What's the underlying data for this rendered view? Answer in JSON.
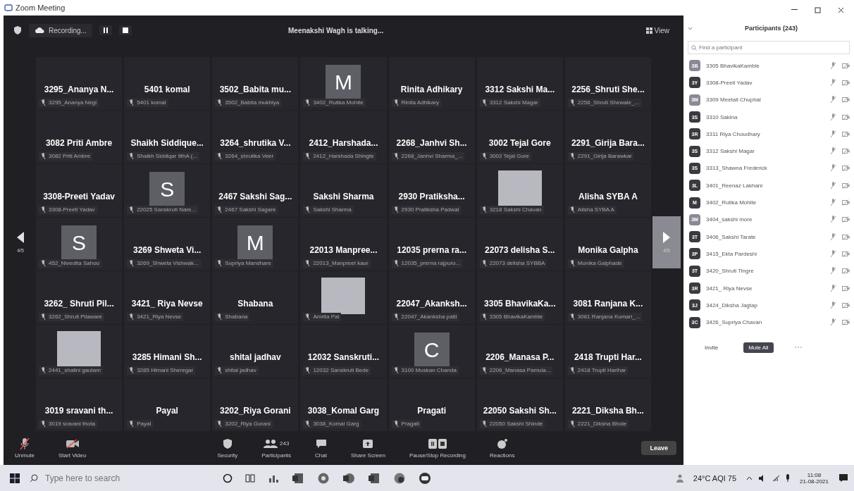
{
  "window": {
    "title": "Zoom Meeting"
  },
  "top_bar": {
    "recording": "Recording...",
    "talking": "Meenakshi Wagh is talking...",
    "view": "View"
  },
  "pager": {
    "prev_page": "4/5",
    "next_page": "4/5"
  },
  "tiles": [
    {
      "kind": "name",
      "title": "3295_Ananya N...",
      "label": "3295_Ananya Negi"
    },
    {
      "kind": "name",
      "title": "5401 komal",
      "label": "5401 komal"
    },
    {
      "kind": "name",
      "title": "3502_Babita mu...",
      "label": "3502_Babita mukhiya"
    },
    {
      "kind": "letter",
      "title": "M",
      "label": "3402_Rutika Mohite"
    },
    {
      "kind": "name",
      "title": "Rinita Adhikary",
      "label": "Rinita Adhikary"
    },
    {
      "kind": "name",
      "title": "3312 Sakshi Ma...",
      "label": "3312 Sakshi Magar"
    },
    {
      "kind": "name",
      "title": "2256_Shruti She...",
      "label": "2256_Shruti Shewale_..."
    },
    {
      "kind": "name",
      "title": "3082 Priti Ambre",
      "label": "3082 Priti Ambre"
    },
    {
      "kind": "name",
      "title": "Shaikh Siddique...",
      "label": "Shaikh Siddiqar 9thA (..."
    },
    {
      "kind": "name",
      "title": "3264_shrutika V...",
      "label": "3264_shrutika Veer"
    },
    {
      "kind": "name",
      "title": "2412_Harshada...",
      "label": "2412_Harshada Shingte"
    },
    {
      "kind": "name",
      "title": "2268_Janhvi Sh...",
      "label": "2268_Janhvi Sharma_..."
    },
    {
      "kind": "name",
      "title": "3002 Tejal Gore",
      "label": "3002 Tejal Gore"
    },
    {
      "kind": "name",
      "title": "2291_Girija Bara...",
      "label": "2291_Girija Barawkar"
    },
    {
      "kind": "name",
      "title": "3308-Preeti Yadav",
      "label": "3308-Preeti Yadav"
    },
    {
      "kind": "letter",
      "title": "S",
      "label": "22025 Sanskruti Nare..."
    },
    {
      "kind": "name",
      "title": "2467 Sakshi Sag...",
      "label": "2467 Sakshi Sagare"
    },
    {
      "kind": "name",
      "title": "Sakshi Sharma",
      "label": "Sakshi Sharma"
    },
    {
      "kind": "name",
      "title": "2930 Pratiksha...",
      "label": "2930 Pratiksha Padwal"
    },
    {
      "kind": "photo",
      "label": "3218 Sakshi Chavan"
    },
    {
      "kind": "name",
      "title": "Alisha SYBA A",
      "label": "Alisha SYBA A"
    },
    {
      "kind": "letter",
      "title": "S",
      "label": "452_Nivedita Sahoo"
    },
    {
      "kind": "name",
      "title": "3269 Shweta Vi...",
      "label": "3269_Shweta Vishwak..."
    },
    {
      "kind": "letter",
      "title": "M",
      "label": "Supriya Mandhare"
    },
    {
      "kind": "name",
      "title": "22013 Manpree...",
      "label": "22013_Manpreet kaur"
    },
    {
      "kind": "name",
      "title": "12035 prerna ra...",
      "label": "12035_prerna rajpuro..."
    },
    {
      "kind": "name",
      "title": "22073 delisha S...",
      "label": "22073 delisha SYBBA"
    },
    {
      "kind": "name",
      "title": "Monika Galpha",
      "label": "Monika Galphade"
    },
    {
      "kind": "name",
      "title": "3262_ Shruti Pil...",
      "label": "3262_Shruti Pilaware"
    },
    {
      "kind": "name",
      "title": "3421_ Riya Nevse",
      "label": "3421_Riya Nevse"
    },
    {
      "kind": "name",
      "title": "Shabana",
      "label": "Shabana"
    },
    {
      "kind": "photo",
      "label": "Amrita Pal"
    },
    {
      "kind": "name",
      "title": "22047_Akanksh...",
      "label": "22047_Akanksha patil"
    },
    {
      "kind": "name",
      "title": "3305 BhavikaKa...",
      "label": "3305 BhavikaKamble"
    },
    {
      "kind": "name",
      "title": "3081 Ranjana K...",
      "label": "3081 Ranjana Kumari_..."
    },
    {
      "kind": "photo",
      "label": "2441_shalini gautam"
    },
    {
      "kind": "name",
      "title": "3285 Himani Sh...",
      "label": "3285 Himani Sheregar"
    },
    {
      "kind": "name",
      "title": "shital jadhav",
      "label": "shital jadhav"
    },
    {
      "kind": "name",
      "title": "12032 Sanskruti...",
      "label": "12032 Sanskruti Bede"
    },
    {
      "kind": "letter",
      "title": "C",
      "label": "3100 Muskan Chanda"
    },
    {
      "kind": "name",
      "title": "2206_Manasa P...",
      "label": "2206_Manasa Pamula..."
    },
    {
      "kind": "name",
      "title": "2418 Trupti Har...",
      "label": "2418 Trupti Harihar"
    },
    {
      "kind": "name",
      "title": "3019 sravani th...",
      "label": "3019 sravani thota"
    },
    {
      "kind": "name",
      "title": "Payal",
      "label": "Payal"
    },
    {
      "kind": "name",
      "title": "3202_Riya Gorani",
      "label": "3202_Riya Gorani"
    },
    {
      "kind": "name",
      "title": "3038_Komal Garg",
      "label": "3038_Komal Garg"
    },
    {
      "kind": "name",
      "title": "Pragati",
      "label": "Pragati"
    },
    {
      "kind": "name",
      "title": "22050 Sakshi Sh...",
      "label": "22050 Sakshi Shinde"
    },
    {
      "kind": "name",
      "title": "2221_Diksha Bh...",
      "label": "2221_Diksha Bhole"
    }
  ],
  "toolbar": [
    {
      "kind": "mic",
      "label": "Unmute"
    },
    {
      "kind": "video",
      "label": "Start Video"
    },
    {
      "kind": "spacer"
    },
    {
      "kind": "shield",
      "label": "Security"
    },
    {
      "kind": "people",
      "label": "Participants",
      "count": "243"
    },
    {
      "kind": "chat",
      "label": "Chat"
    },
    {
      "kind": "share",
      "label": "Share Screen"
    },
    {
      "kind": "record",
      "label": "Pause/Stop Recording"
    },
    {
      "kind": "reactions",
      "label": "Reactions"
    }
  ],
  "leave_button": "Leave",
  "participants_panel": {
    "title": "Participants (243)",
    "search": {
      "placeholder": "Find a participant"
    },
    "items": [
      {
        "initials": "3B",
        "name": "3305 BhavikaKamble",
        "color": "#8a8a96"
      },
      {
        "initials": "3Y",
        "name": "3308-Preeti Yadav",
        "color": "#3a3a40"
      },
      {
        "initials": "3M",
        "name": "3309 Meetali Chuphal",
        "color": "#8a8a96"
      },
      {
        "initials": "3S",
        "name": "3310 Sakina",
        "color": "#3a3a40"
      },
      {
        "initials": "3R",
        "name": "3311 Riya Choudhary",
        "color": "#3a3a40"
      },
      {
        "initials": "3S",
        "name": "3312 Sakshi Magar",
        "color": "#3a3a40"
      },
      {
        "initials": "3S",
        "name": "3313_Shawna Frederick",
        "color": "#3a3a40"
      },
      {
        "initials": "3L",
        "name": "3401_Reenaz Lakhani",
        "color": "#3a3a40"
      },
      {
        "initials": "M",
        "name": "3402_Rutika Mohite",
        "color": "#3a3a40"
      },
      {
        "initials": "3M",
        "name": "3404_sakshi more",
        "color": "#8a8a96"
      },
      {
        "initials": "3T",
        "name": "3406_Sakshi Tarate",
        "color": "#3a3a40"
      },
      {
        "initials": "3P",
        "name": "3415_Ekta Pardeshi",
        "color": "#3a3a40"
      },
      {
        "initials": "3T",
        "name": "3420_Shruti Tingre",
        "color": "#3a3a40"
      },
      {
        "initials": "3R",
        "name": "3421_ Riya Nevse",
        "color": "#3a3a40"
      },
      {
        "initials": "3J",
        "name": "3424_Diksha Jagtap",
        "color": "#3a3a40"
      },
      {
        "initials": "3C",
        "name": "3426_Supriya Chavan",
        "color": "#3a3a40"
      }
    ],
    "invite": "Invite",
    "mute_all": "Mute All"
  },
  "taskbar": {
    "search": {
      "placeholder": "Type here to search"
    },
    "weather": "24°C AQI 75",
    "time": "11:08",
    "date": "21-08-2021"
  }
}
